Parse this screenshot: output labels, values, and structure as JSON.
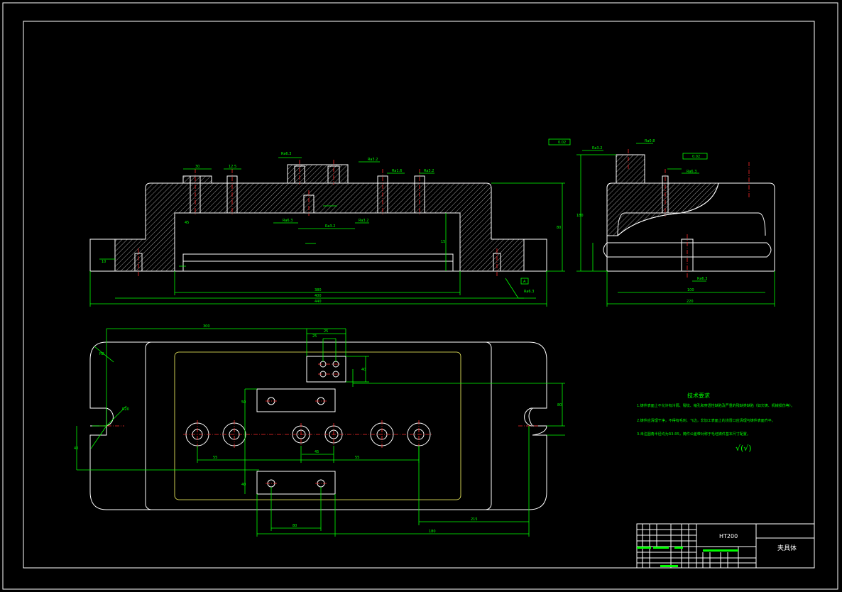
{
  "title_block": {
    "material": "HT200",
    "part_name": "夹具体"
  },
  "tech_req": {
    "title": "技术要求",
    "items": [
      "1.铸件表面上不允许有冷隔、裂纹、缩孔和穿透性缺陷及严重的残缺类缺陷（如欠铸、机械损伤等）。",
      "2.铸件应清理干净，不得有毛刺、飞边，非加工表面上的浇冒口应清理与铸件表面齐平。",
      "3.未注圆角半径均为R3-R5，铸件公差带对称于毛坯铸件基本尺寸配置。"
    ],
    "roughness_symbol": "√(√)"
  },
  "front_view": {
    "dim_labels": [
      "30",
      "12.5",
      "Ra6.3",
      "Ra3.2",
      "Ra1.6",
      "Ra3.2",
      "Ra3.2",
      "Ra6.3",
      "Ra3.2",
      "80",
      "15",
      "10",
      "380",
      "400",
      "440",
      "45",
      "Ra6.3",
      "A"
    ]
  },
  "side_view": {
    "dim_labels": [
      "0.02",
      "Ra3.2",
      "Ra0.8",
      "0.02",
      "Ra6.3",
      "100",
      "180",
      "220",
      "Ra6.3"
    ]
  },
  "top_view": {
    "dim_labels": [
      "300",
      "25",
      "40",
      "25",
      "50",
      "R8",
      "R20",
      "40",
      "80",
      "55",
      "45",
      "55",
      "215",
      "80",
      "180",
      "40"
    ]
  }
}
